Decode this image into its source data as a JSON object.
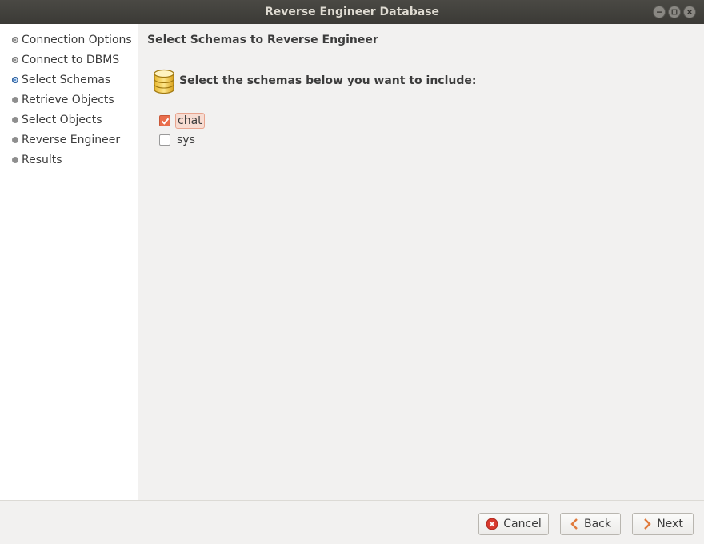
{
  "window": {
    "title": "Reverse Engineer Database"
  },
  "sidebar": {
    "steps": [
      {
        "label": "Connection Options",
        "state": "done"
      },
      {
        "label": "Connect to DBMS",
        "state": "done"
      },
      {
        "label": "Select Schemas",
        "state": "current"
      },
      {
        "label": "Retrieve Objects",
        "state": "pending"
      },
      {
        "label": "Select Objects",
        "state": "pending"
      },
      {
        "label": "Reverse Engineer",
        "state": "pending"
      },
      {
        "label": "Results",
        "state": "pending"
      }
    ]
  },
  "main": {
    "title": "Select Schemas to Reverse Engineer",
    "instruction": "Select the schemas below you want to include:",
    "schemas": [
      {
        "name": "chat",
        "checked": true
      },
      {
        "name": "sys",
        "checked": false
      }
    ]
  },
  "footer": {
    "cancel_label": "Cancel",
    "back_label": "Back",
    "next_label": "Next"
  },
  "icons": {
    "database": "database-icon",
    "cancel": "cancel-icon",
    "back": "chevron-left-icon",
    "next": "chevron-right-icon"
  },
  "colors": {
    "accent": "#e96e4c",
    "current_step": "#3d7cc9",
    "titlebar": "#3b3a36"
  }
}
